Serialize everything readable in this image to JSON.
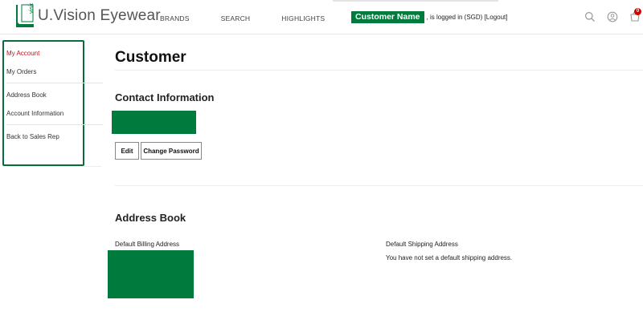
{
  "brand": {
    "name": "U.Vision Eyewear",
    "mark_text": "vision",
    "color": "#007a3d"
  },
  "nav": {
    "items": [
      "BRANDS",
      "SEARCH",
      "HIGHLIGHTS"
    ]
  },
  "header": {
    "customer_name": "Customer Name",
    "login_status": ", is logged in (SGD)",
    "logout_label": "[Logout]",
    "icons": [
      "search-icon",
      "user-icon",
      "cart-icon"
    ],
    "cart_count": "0"
  },
  "sidebar": {
    "border_color": "#0b6b3a",
    "active_color": "#c1121f",
    "items": [
      {
        "label": "My Account",
        "active": true
      },
      {
        "label": "My Orders"
      },
      {
        "label": "Address Book"
      },
      {
        "label": "Account Information"
      },
      {
        "label": "Back to Sales Rep"
      }
    ]
  },
  "main": {
    "title": "Customer",
    "contact": {
      "title": "Contact Information",
      "edit_label": "Edit",
      "change_password_label": "Change Password"
    },
    "address_book": {
      "title": "Address Book",
      "billing_label": "Default Billing Address",
      "shipping_label": "Default Shipping Address",
      "shipping_text": "You have not set a default shipping address."
    }
  }
}
